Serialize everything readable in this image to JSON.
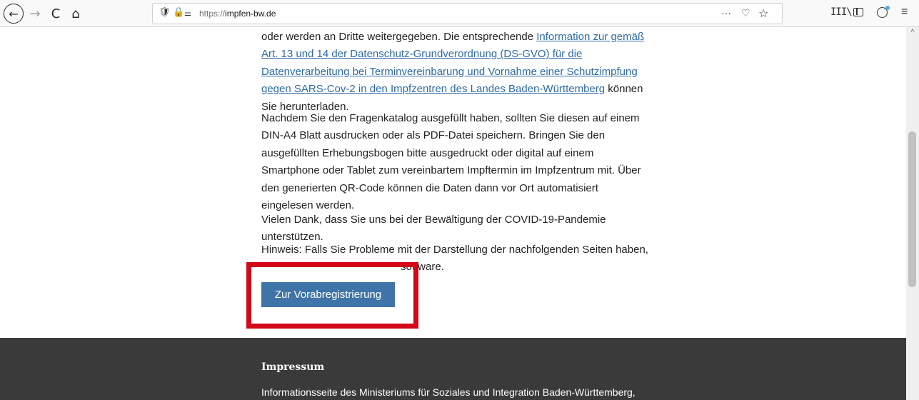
{
  "browser": {
    "url_prefix": "https://",
    "url_domain": "impfen-bw.de",
    "icons": {
      "back": "←",
      "forward": "→",
      "reload": "C",
      "home": "⌂",
      "shield": "🛡",
      "lock": "🔒",
      "permissions": "⚌",
      "more": "···",
      "pocket": "♡",
      "bookmark": "☆",
      "library": "III\\",
      "menu": "≡",
      "scroll_up": "^"
    }
  },
  "content": {
    "p1_lead": "oder werden an Dritte weitergegeben. Die entsprechende ",
    "p1_link": "Information zur gemäß Art. 13 und 14 der Datenschutz-Grundverordnung (DS-GVO) für die Datenverarbeitung bei Terminvereinbarung und Vornahme einer Schutzimpfung gegen SARS-Cov-2 in den Impfzentren des Landes Baden-Württemberg",
    "p1_tail": " können Sie herunterladen.",
    "p2": "Nachdem Sie den Fragenkatalog ausgefüllt haben, sollten Sie diesen auf einem DIN-A4 Blatt ausdrucken oder als PDF-Datei speichern. Bringen Sie den ausgefüllten Erhebungsbogen bitte ausgedruckt oder digital auf einem Smartphone oder Tablet zum vereinbartem Impftermin im Impfzentrum mit. Über den generierten QR-Code können die Daten dann vor Ort automatisiert eingelesen werden.",
    "p3": "Vielen Dank, dass Sie uns bei der Bewältigung der COVID-19-Pandemie unterstützen.",
    "p4_line1": "Hinweis: Falls Sie Probleme mit der Darstellung der nachfolgenden Seiten haben,",
    "p4_line2": "software.",
    "register_button": "Zur Vorabregistrierung"
  },
  "footer": {
    "title": "Impressum",
    "text": "Informationsseite des Ministeriums für Soziales und Integration Baden-Württemberg,"
  },
  "colors": {
    "link": "#2e6ba8",
    "button": "#3f74a8",
    "annotation": "#d2081a",
    "footer_bg": "#3a3a3a"
  }
}
